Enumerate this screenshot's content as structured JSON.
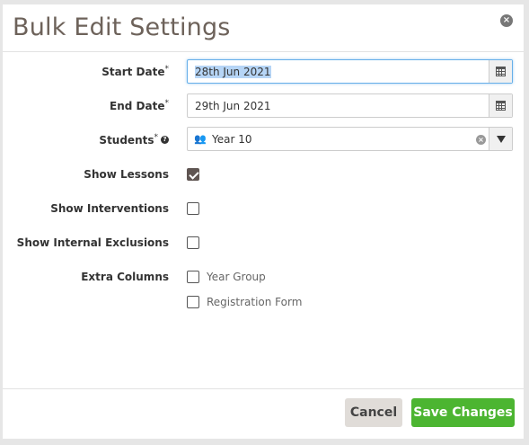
{
  "modal": {
    "title": "Bulk Edit Settings",
    "close_icon": "close-circle-icon"
  },
  "fields": {
    "start_date": {
      "label": "Start Date",
      "required_mark": "*",
      "value": "28th Jun 2021",
      "icon": "calendar-icon"
    },
    "end_date": {
      "label": "End Date",
      "required_mark": "*",
      "value": "29th Jun 2021",
      "icon": "calendar-icon"
    },
    "students": {
      "label": "Students",
      "required_mark": "*",
      "value": "Year 10",
      "icon": "users-icon",
      "help_icon": "question-icon"
    },
    "show_lessons": {
      "label": "Show Lessons",
      "checked": true
    },
    "show_interventions": {
      "label": "Show Interventions",
      "checked": false
    },
    "show_internal_exclusions": {
      "label": "Show Internal Exclusions",
      "checked": false
    },
    "extra_columns": {
      "label": "Extra Columns",
      "options": [
        {
          "label": "Year Group",
          "checked": false
        },
        {
          "label": "Registration Form",
          "checked": false
        }
      ]
    }
  },
  "footer": {
    "cancel_label": "Cancel",
    "save_label": "Save Changes"
  },
  "colors": {
    "save_button": "#4cb531",
    "cancel_button": "#e0dcd8",
    "title": "#6d625a",
    "focus_border": "#66afe9"
  }
}
